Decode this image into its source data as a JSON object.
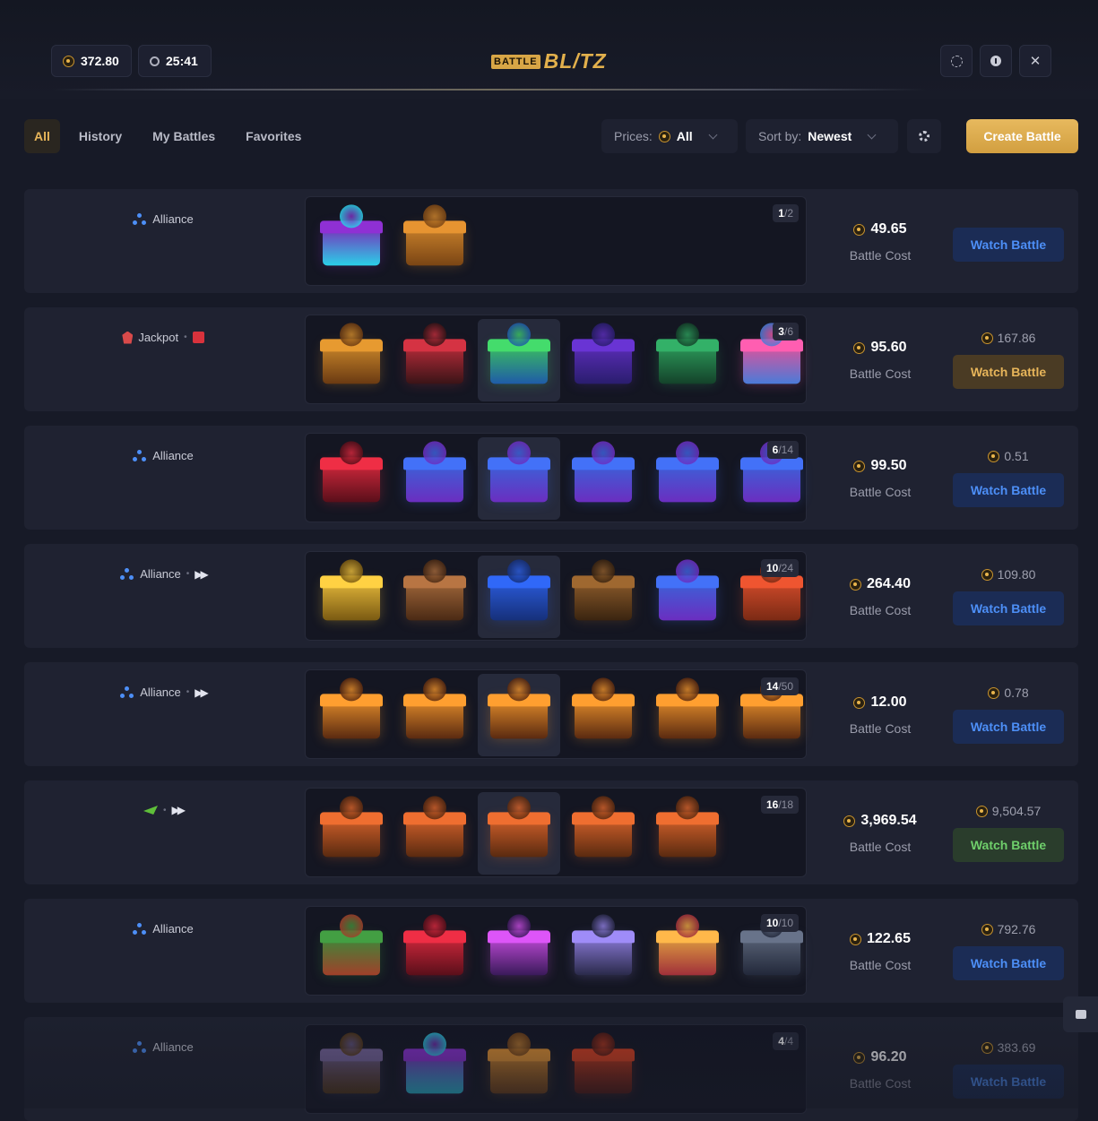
{
  "header": {
    "balance": "372.80",
    "timer": "25:41",
    "logo_small": "BATTLE",
    "logo_large": "BL/TZ"
  },
  "tabs": [
    {
      "label": "All",
      "active": true
    },
    {
      "label": "History"
    },
    {
      "label": "My Battles"
    },
    {
      "label": "Favorites"
    }
  ],
  "filters": {
    "prices_label": "Prices:",
    "prices_value": "All",
    "sort_label": "Sort by:",
    "sort_value": "Newest"
  },
  "create_button": "Create Battle",
  "cost_caption": "Battle Cost",
  "rows": [
    {
      "team": "Alliance",
      "team_icon": "alliance-icon",
      "fast_forward": false,
      "count_a": "1",
      "count_b": "/2",
      "cost": "49.65",
      "win": "",
      "button": "Watch Battle",
      "button_color": "blue"
    },
    {
      "team": "Jackpot",
      "team_icon": "jackpot-icon",
      "fast_forward": false,
      "count_a": "3",
      "count_b": "/6",
      "cost": "95.60",
      "win": "167.86",
      "button": "Watch Battle",
      "button_color": "gold"
    },
    {
      "team": "Alliance",
      "team_icon": "alliance-icon",
      "fast_forward": false,
      "count_a": "6",
      "count_b": "/14",
      "cost": "99.50",
      "win": "0.51",
      "button": "Watch Battle",
      "button_color": "blue"
    },
    {
      "team": "Alliance",
      "team_icon": "alliance-icon",
      "fast_forward": true,
      "count_a": "10",
      "count_b": "/24",
      "cost": "264.40",
      "win": "109.80",
      "button": "Watch Battle",
      "button_color": "blue"
    },
    {
      "team": "Alliance",
      "team_icon": "alliance-icon",
      "fast_forward": true,
      "count_a": "14",
      "count_b": "/50",
      "cost": "12.00",
      "win": "0.78",
      "button": "Watch Battle",
      "button_color": "blue"
    },
    {
      "team": "",
      "team_icon": "bird-icon",
      "fast_forward": true,
      "count_a": "16",
      "count_b": "/18",
      "cost": "3,969.54",
      "win": "9,504.57",
      "button": "Watch Battle",
      "button_color": "green"
    },
    {
      "team": "Alliance",
      "team_icon": "alliance-icon",
      "fast_forward": false,
      "count_a": "10",
      "count_b": "/10",
      "cost": "122.65",
      "win": "792.76",
      "button": "Watch Battle",
      "button_color": "blue"
    },
    {
      "team": "Alliance",
      "team_icon": "alliance-icon",
      "fast_forward": false,
      "count_a": "4",
      "count_b": "/4",
      "cost": "96.20",
      "win": "383.69",
      "button": "Watch Battle",
      "button_color": "blue"
    }
  ]
}
